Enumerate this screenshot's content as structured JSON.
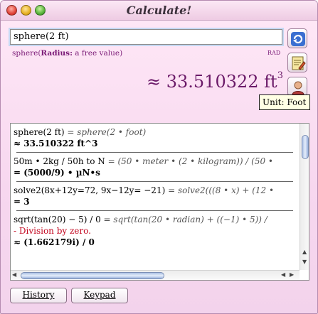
{
  "window": {
    "title": "Calculate!"
  },
  "input": {
    "value": "sphere(2 ft)"
  },
  "hint": {
    "func": "sphere(",
    "arg_label": "Radius:",
    "arg_desc": " a free value)"
  },
  "angle_mode": "RAD",
  "result": {
    "approx": "≈ 33.510322 ft",
    "exponent": "3"
  },
  "unit_tooltip": "Unit: Foot",
  "side_buttons": [
    {
      "icon": "evaluate-icon"
    },
    {
      "icon": "notepad-icon"
    },
    {
      "icon": "user-icon"
    }
  ],
  "history": [
    {
      "input": "sphere(2 ft)",
      "parsed": " = sphere(2 • foot)",
      "result": "≈ 33.510322 ft^3"
    },
    {
      "input": "50m • 2kg / 50h to N",
      "parsed": " = (50 • meter • (2 • kilogram)) / (50 •",
      "result": "= (5000/9) • µN•s"
    },
    {
      "input": "solve2(8x+12y=72, 9x−12y= −21)",
      "parsed": " = solve2(((8 • x) + (12 •",
      "result": "= 3"
    },
    {
      "input": "sqrt(tan(20) − 5) / 0",
      "parsed": " = sqrt(tan(20 • radian) + ((−1) • 5)) /",
      "error": "- Division by zero.",
      "result": "≈ (1.662179i) / 0"
    }
  ],
  "tabs": {
    "history": "History",
    "keypad": "Keypad"
  },
  "colors": {
    "accent": "#6b1a68",
    "error": "#c2041d",
    "background": "#f7d7ef"
  }
}
